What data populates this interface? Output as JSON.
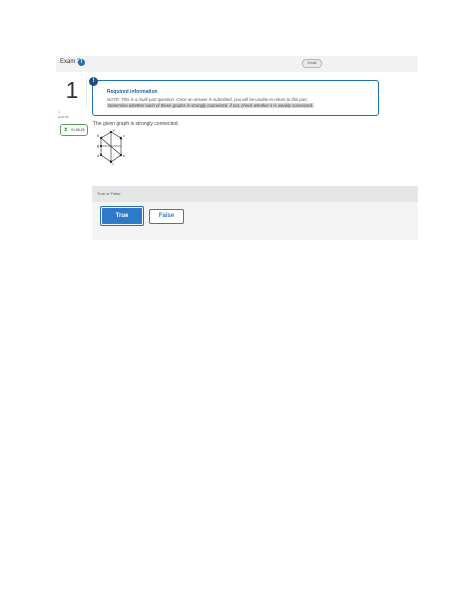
{
  "header": {
    "exam_title": "Exam 3",
    "info_icon_glyph": "i",
    "email_label": "Email"
  },
  "question": {
    "number": "1",
    "points_line1": "1",
    "points_line2": "points",
    "timer": "01:58:25",
    "timer_icon": "hourglass-icon"
  },
  "required_info": {
    "badge": "!",
    "title": "Required information",
    "note": "NOTE: This is a multi-part question. Once an answer is submitted, you will be unable to return to this part.",
    "instruction": "Determine whether each of these graphs is strongly connected, if not, check whether it is weakly connected."
  },
  "statement": "The given graph is strongly connected.",
  "graph_labels": {
    "a": "a",
    "b": "b",
    "c": "c",
    "d": "d",
    "e": "e",
    "f": "f",
    "g": "g"
  },
  "answer": {
    "type_label": "True or False",
    "true_label": "True",
    "false_label": "False"
  },
  "colors": {
    "accent": "#2f7ac8",
    "header_bg": "#f2f2f2",
    "panel_bg": "#f4f4f4",
    "timer_border": "#5aa05a"
  }
}
